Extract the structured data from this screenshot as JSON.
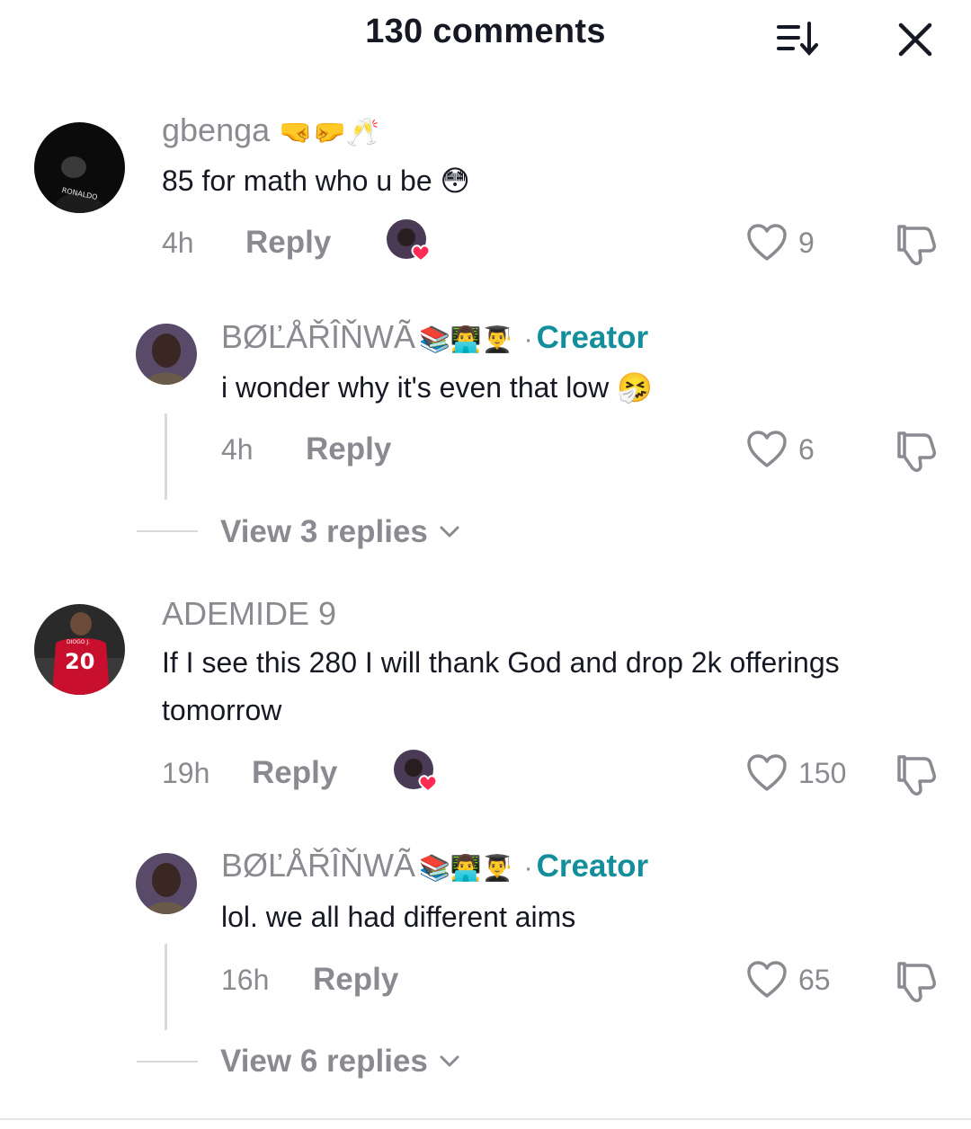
{
  "header": {
    "title": "130 comments",
    "sort_icon": "sort-descending-icon",
    "close_icon": "close-icon"
  },
  "colors": {
    "accent_creator": "#138f9c",
    "muted_text": "#8a8b91",
    "primary_text": "#161823",
    "heart_red": "#fe2c55"
  },
  "comments": [
    {
      "username": "gbenga",
      "username_emojis": "🤜🤛🥂",
      "avatar_text": "RONALDO",
      "text": "85 for math who u be 😳",
      "time": "4h",
      "reply_label": "Reply",
      "likes": "9",
      "creator_liked": true
    },
    {
      "username": "ADEMIDE 9",
      "avatar_text": "DIOGO J.",
      "avatar_number": "20",
      "text_line1": "If I see this 280 I will thank God and drop 2k offerings",
      "text_line2": "tomorrow",
      "time": "19h",
      "reply_label": "Reply",
      "likes": "150",
      "creator_liked": true
    }
  ],
  "replies": [
    {
      "username": "BØĽÅŘÎŇWÃ",
      "username_emojis": "📚👨‍💻👨‍🎓",
      "badge": "Creator",
      "text": "i wonder why it's even that low 🤧",
      "time": "4h",
      "reply_label": "Reply",
      "likes": "6",
      "view_replies": "View 3 replies"
    },
    {
      "username": "BØĽÅŘÎŇWÃ",
      "username_emojis": "📚👨‍💻👨‍🎓",
      "badge": "Creator",
      "text": "lol. we all had different aims",
      "time": "16h",
      "reply_label": "Reply",
      "likes": "65",
      "view_replies": "View 6 replies"
    }
  ]
}
